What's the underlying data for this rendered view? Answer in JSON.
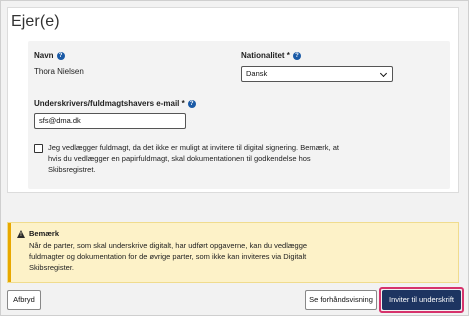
{
  "section": {
    "title": "Ejer(e)"
  },
  "fields": {
    "name_label": "Navn",
    "name_value": "Thora Nielsen",
    "nationality_label": "Nationalitet *",
    "nationality_value": "Dansk",
    "email_label": "Underskrivers/fuldmagtshavers e-mail *",
    "email_value": "sfs@dma.dk",
    "checkbox_checked": false,
    "checkbox_text": "Jeg vedlægger fuldmagt, da det ikke er muligt at invitere til digital signering. Bemærk, at hvis du vedlægger en papirfuldmagt, skal dokumentationen til godkendelse hos Skibsregistret."
  },
  "notice": {
    "title": "Bemærk",
    "body": "Når de parter, som skal underskrive digitalt, har udført opgaverne, kan du vedlægge fuldmagter og dokumentation for de øvrige parter, som ikke kan inviteres via Digitalt Skibsregister."
  },
  "footer": {
    "cancel_label": "Afbryd",
    "preview_label": "Se forhåndsvisning",
    "invite_label": "Inviter til underskrift"
  },
  "colors": {
    "primary": "#1d3461",
    "focus_ring": "#d6336c",
    "help_icon": "#1a5aa6",
    "notice_bg": "#fdf2c8",
    "notice_accent": "#e8a800"
  }
}
